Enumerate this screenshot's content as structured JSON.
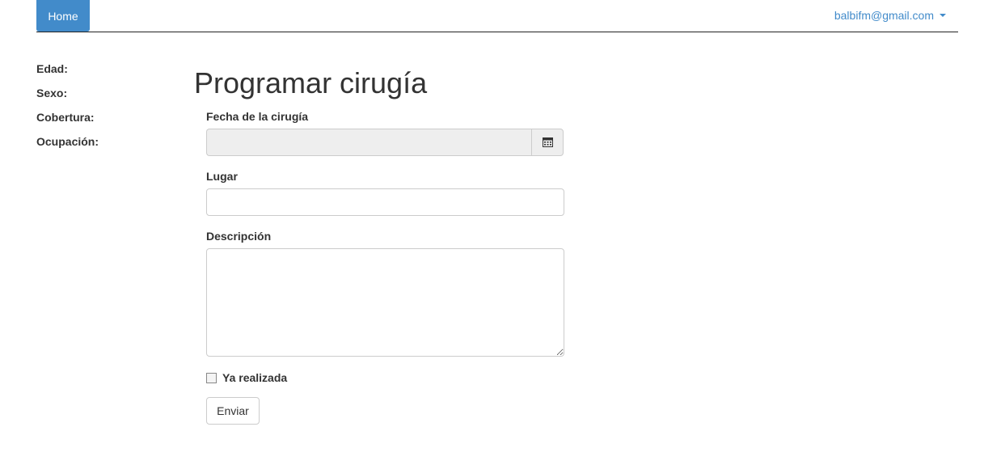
{
  "navbar": {
    "home_label": "Home",
    "user_email": "balbifm@gmail.com"
  },
  "sidebar": {
    "items": [
      {
        "label": "Edad:"
      },
      {
        "label": "Sexo:"
      },
      {
        "label": "Cobertura:"
      },
      {
        "label": "Ocupación:"
      }
    ]
  },
  "page": {
    "title": "Programar cirugía"
  },
  "form": {
    "date_label": "Fecha de la cirugía",
    "date_value": "",
    "place_label": "Lugar",
    "place_value": "",
    "description_label": "Descripción",
    "description_value": "",
    "done_label": "Ya realizada",
    "done_checked": false,
    "submit_label": "Enviar"
  },
  "colors": {
    "primary": "#428bca",
    "text": "#333333",
    "border": "#cccccc",
    "disabled_bg": "#eeeeee"
  },
  "icons": {
    "date_addon": "calendar-icon",
    "user_menu": "caret-down-icon"
  }
}
